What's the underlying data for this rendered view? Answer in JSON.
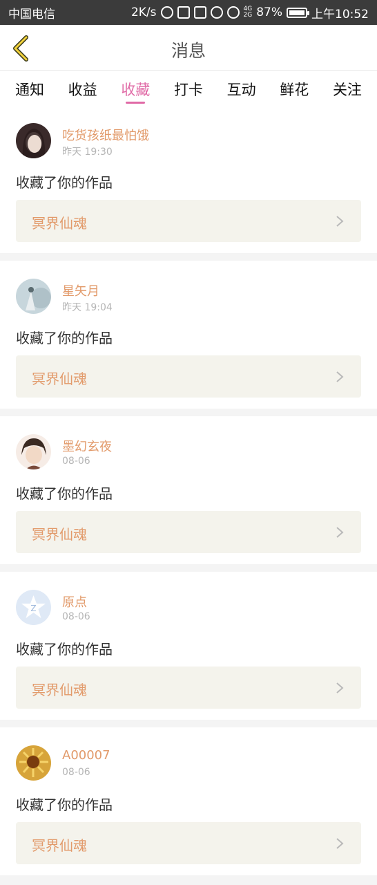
{
  "status_bar": {
    "carrier": "中国电信",
    "speed": "2K/s",
    "network": [
      "4G",
      "2G"
    ],
    "battery": "87%",
    "time": "上午10:52"
  },
  "header": {
    "title": "消息",
    "back_icon": "chevron-left-icon"
  },
  "tabs": [
    {
      "label": "通知",
      "active": false
    },
    {
      "label": "收益",
      "active": false
    },
    {
      "label": "收藏",
      "active": true
    },
    {
      "label": "打卡",
      "active": false
    },
    {
      "label": "互动",
      "active": false
    },
    {
      "label": "鲜花",
      "active": false
    },
    {
      "label": "关注",
      "active": false
    }
  ],
  "items": [
    {
      "user": "吃货孩纸最怕饿",
      "time": "昨天 19:30",
      "action": "收藏了你的作品",
      "work": "冥界仙魂"
    },
    {
      "user": "星矢月",
      "time": "昨天 19:04",
      "action": "收藏了你的作品",
      "work": "冥界仙魂"
    },
    {
      "user": "墨幻玄夜",
      "time": "08-06",
      "action": "收藏了你的作品",
      "work": "冥界仙魂"
    },
    {
      "user": "原点",
      "time": "08-06",
      "action": "收藏了你的作品",
      "work": "冥界仙魂"
    },
    {
      "user": "A00007",
      "time": "08-06",
      "action": "收藏了你的作品",
      "work": "冥界仙魂"
    }
  ],
  "colors": {
    "accent": "#e06aa6",
    "name": "#e29a6a",
    "work_bg": "#f4f3ec",
    "status_bar": "#3b3b3b"
  }
}
